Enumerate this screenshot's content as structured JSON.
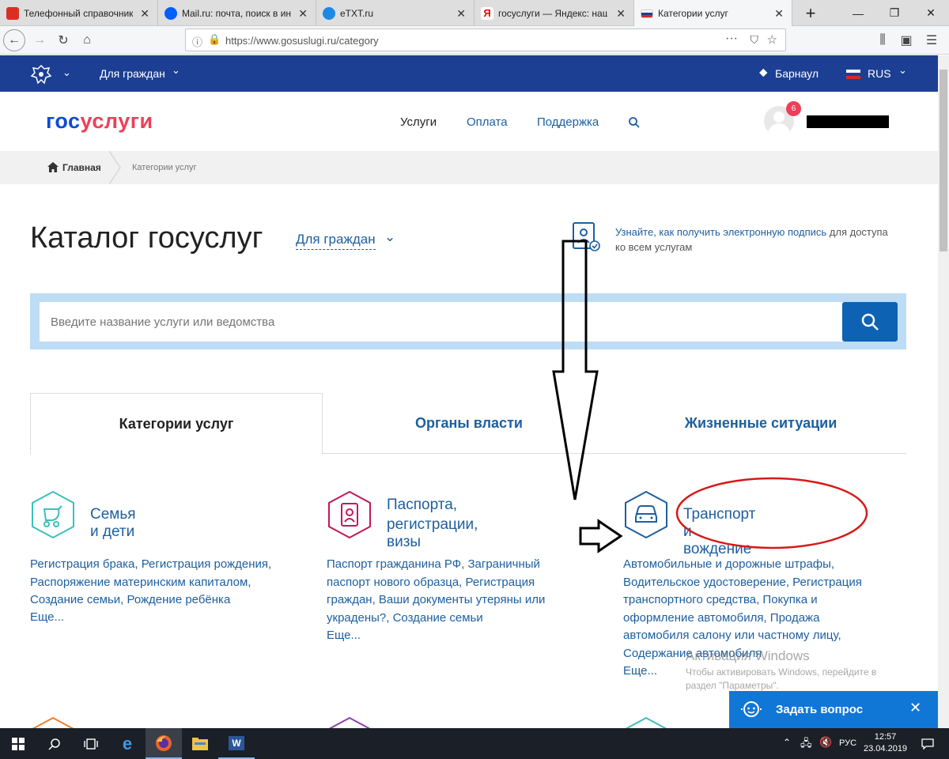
{
  "browser": {
    "tabs": [
      {
        "title": "Телефонный справочник",
        "color": "#d93025",
        "active": false
      },
      {
        "title": "Mail.ru: почта, поиск в интер",
        "color": "#005ff9",
        "active": false
      },
      {
        "title": "eTXT.ru",
        "color": "#1e88e5",
        "active": false
      },
      {
        "title": "госуслуги — Яндекс: нашлос",
        "color": "#ff0000",
        "active": false
      },
      {
        "title": "Категории услуг",
        "color": "#1c3f94",
        "active": true
      }
    ],
    "url": "https://www.gosuslugi.ru/category"
  },
  "topbar": {
    "audience": "Для граждан",
    "city": "Барнаул",
    "lang": "RUS"
  },
  "header": {
    "logo_gos": "гос",
    "logo_uslugi": "услуги",
    "nav": [
      "Услуги",
      "Оплата",
      "Поддержка"
    ],
    "notifications": "6"
  },
  "breadcrumb": {
    "home": "Главная",
    "current": "Категории услуг"
  },
  "catalog": {
    "title": "Каталог госуслуг",
    "audience": "Для граждан",
    "esign_link": "Узнайте, как получить электронную подпись",
    "esign_rest_1": "для доступа",
    "esign_rest_2": "ко всем услугам",
    "search_placeholder": "Введите название услуги или ведомства"
  },
  "tabs": [
    "Категории услуг",
    "Органы власти",
    "Жизненные ситуации"
  ],
  "categories": [
    {
      "title1": "Семья и дети",
      "title2": "",
      "links": "Регистрация брака, Регистрация рождения, Распоряжение материнским капиталом, Создание семьи, Рождение ребёнка",
      "more": "Еще..."
    },
    {
      "title1": "Паспорта,",
      "title2": "регистрации, визы",
      "links": "Паспорт гражданина РФ, Заграничный паспорт нового образца, Регистрация граждан, Ваши документы утеряны или украдены?, Создание семьи",
      "more": "Еще..."
    },
    {
      "title1": "Транспорт и вождение",
      "title2": "",
      "links": "Автомобильные и дорожные штрафы, Водительское удостоверение, Регистрация транспортного средства, Покупка и оформление автомобиля, Продажа автомобиля салону или частному лицу, Содержание автомобиля",
      "more": "Еще..."
    }
  ],
  "watermark": {
    "line1": "Активация Windows",
    "line2": "Чтобы активировать Windows, перейдите в",
    "line3": "раздел \"Параметры\"."
  },
  "ask_widget": {
    "label": "Задать вопрос"
  },
  "taskbar": {
    "lang": "РУС",
    "time": "12:57",
    "date": "23.04.2019"
  },
  "colors": {
    "brand_blue": "#1c3f94",
    "link_blue": "#1d5fa0",
    "logo_red": "#ee3f58",
    "annotation_red": "#d61a1a"
  }
}
